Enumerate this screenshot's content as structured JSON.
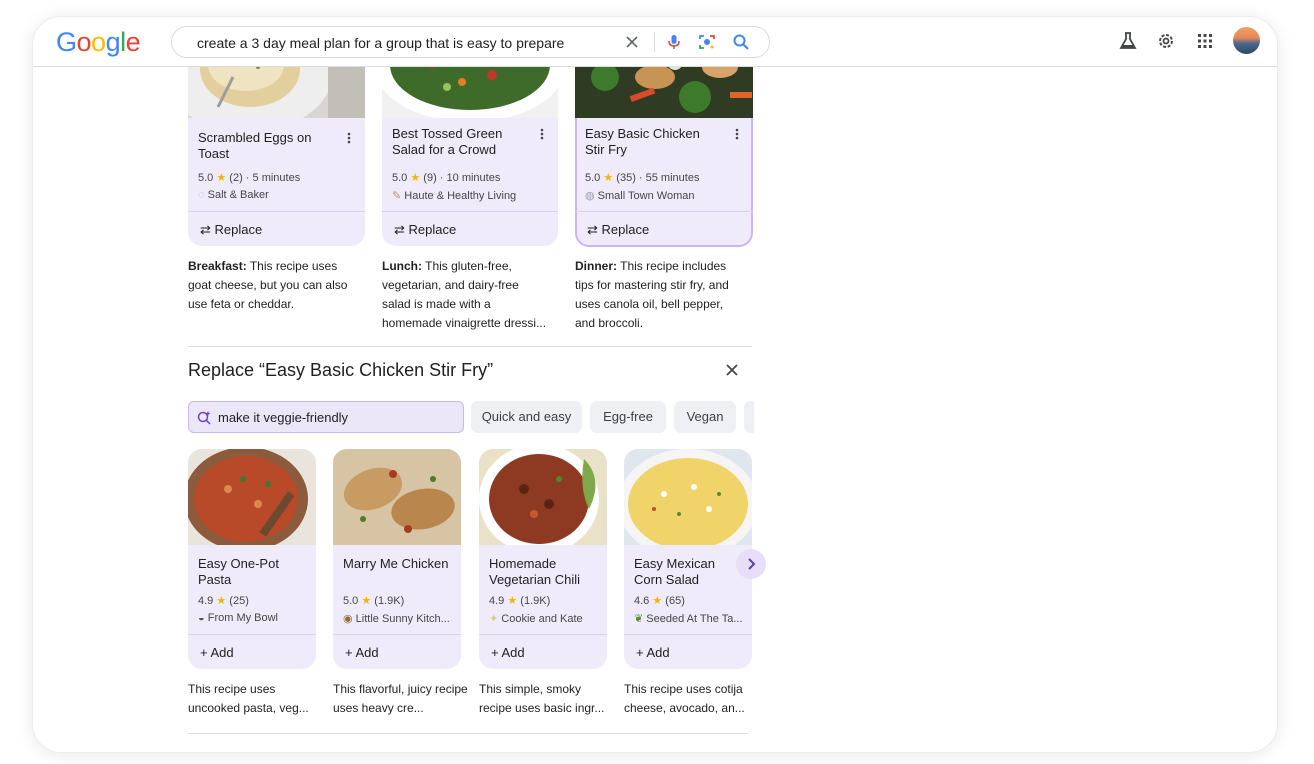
{
  "header": {
    "logo_text": "Google",
    "search_query": "create a 3 day meal plan for a group that is easy to prepare",
    "icons": [
      "close-icon",
      "mic-icon",
      "lens-icon",
      "search-icon",
      "labs-icon",
      "settings-icon",
      "apps-icon",
      "avatar"
    ]
  },
  "meal_plan": [
    {
      "title": "Scrambled Eggs on Toast",
      "rating": "5.0",
      "reviews": "(2)",
      "time": "5 minutes",
      "source": "Salt & Baker",
      "action": "Replace",
      "desc_label": "Breakfast:",
      "desc_text": "This recipe uses goat cheese, but you can also use feta or cheddar."
    },
    {
      "title": "Best Tossed Green Salad for a Crowd",
      "rating": "5.0",
      "reviews": "(9)",
      "time": "10 minutes",
      "source": "Haute & Healthy Living",
      "action": "Replace",
      "desc_label": "Lunch:",
      "desc_text": "This gluten-free, vegetarian, and dairy-free salad is made with a homemade vinaigrette dressi..."
    },
    {
      "title": "Easy Basic Chicken Stir Fry",
      "rating": "5.0",
      "reviews": "(35)",
      "time": "55 minutes",
      "source": "Small Town Woman",
      "action": "Replace",
      "desc_label": "Dinner:",
      "desc_text": "This recipe includes tips for mastering stir fry, and uses canola oil, bell pepper, and broccoli."
    }
  ],
  "replace_panel": {
    "title": "Replace “Easy Basic Chicken Stir Fry”",
    "input_value": "make it veggie-friendly",
    "chips": [
      "Quick and easy",
      "Egg-free",
      "Vegan"
    ],
    "recipes": [
      {
        "title": "Easy One-Pot Pasta",
        "rating": "4.9",
        "reviews": "(25)",
        "source": "From My Bowl",
        "action": "Add",
        "desc": "This recipe uses uncooked pasta, veg..."
      },
      {
        "title": "Marry Me Chicken",
        "rating": "5.0",
        "reviews": "(1.9K)",
        "source": "Little Sunny Kitch...",
        "action": "Add",
        "desc": "This flavorful, juicy recipe uses heavy cre..."
      },
      {
        "title": "Homemade Vegetarian Chili",
        "rating": "4.9",
        "reviews": "(1.9K)",
        "source": "Cookie and Kate",
        "action": "Add",
        "desc": "This simple, smoky recipe uses basic ingr..."
      },
      {
        "title": "Easy Mexican Corn Salad",
        "rating": "4.6",
        "reviews": "(65)",
        "source": "Seeded At The Ta...",
        "action": "Add",
        "desc": "This recipe uses cotija cheese, avocado, an..."
      }
    ]
  },
  "colors": {
    "card_bg": "#efebfa",
    "selected_outline": "#c9b6f3",
    "star": "#f4b400"
  }
}
